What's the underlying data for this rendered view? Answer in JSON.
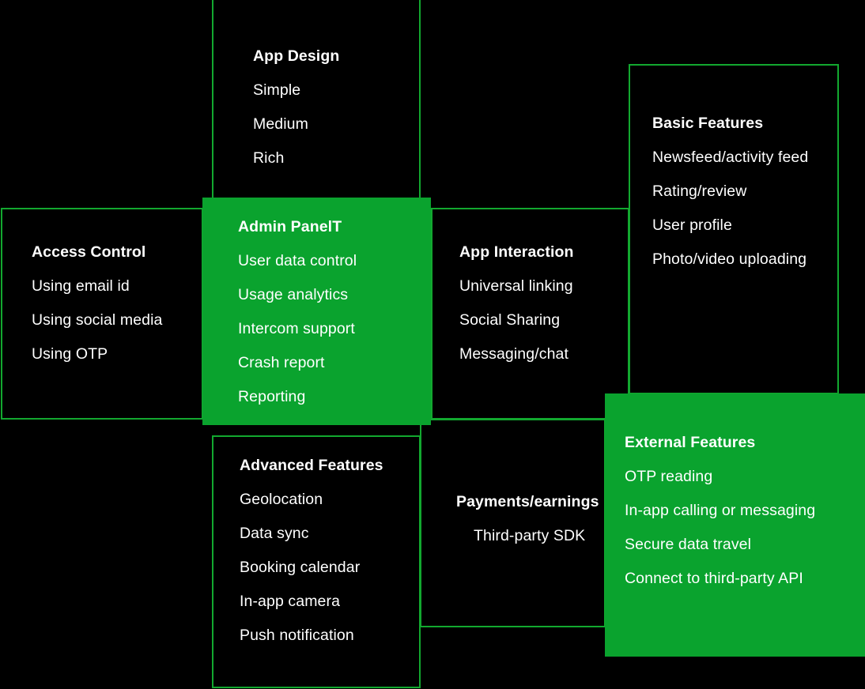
{
  "diagram": {
    "type": "feature-map",
    "background_color": "#000000",
    "accent_color": "#0aa32e",
    "border_color": "#12a82f",
    "text_color": "#ffffff",
    "nodes": [
      {
        "id": "app-design",
        "title": "App Design",
        "style": "outlined",
        "items": [
          "Simple",
          "Medium",
          "Rich"
        ]
      },
      {
        "id": "access-control",
        "title": "Access Control",
        "style": "outlined",
        "items": [
          "Using email id",
          "Using social media",
          "Using OTP"
        ]
      },
      {
        "id": "admin-panel",
        "title": "Admin PanelT",
        "style": "filled",
        "items": [
          "User data control",
          "Usage analytics",
          "Intercom support",
          "Crash report",
          "Reporting"
        ]
      },
      {
        "id": "app-interaction",
        "title": "App Interaction",
        "style": "outlined",
        "items": [
          "Universal linking",
          "Social Sharing",
          "Messaging/chat"
        ]
      },
      {
        "id": "basic-features",
        "title": "Basic Features",
        "style": "outlined",
        "items": [
          "Newsfeed/activity feed",
          "Rating/review",
          "User profile",
          "Photo/video uploading"
        ]
      },
      {
        "id": "advanced-features",
        "title": "Advanced Features",
        "style": "outlined",
        "items": [
          "Geolocation",
          "Data sync",
          "Booking calendar",
          "In-app camera",
          "Push notification"
        ]
      },
      {
        "id": "payments",
        "title": "Payments/earnings",
        "style": "outlined",
        "items": [
          "Third-party SDK"
        ]
      },
      {
        "id": "external-features",
        "title": "External Features",
        "style": "filled",
        "items": [
          "OTP reading",
          "In-app calling or messaging",
          "Secure data travel",
          "Connect to third-party API"
        ]
      }
    ]
  }
}
